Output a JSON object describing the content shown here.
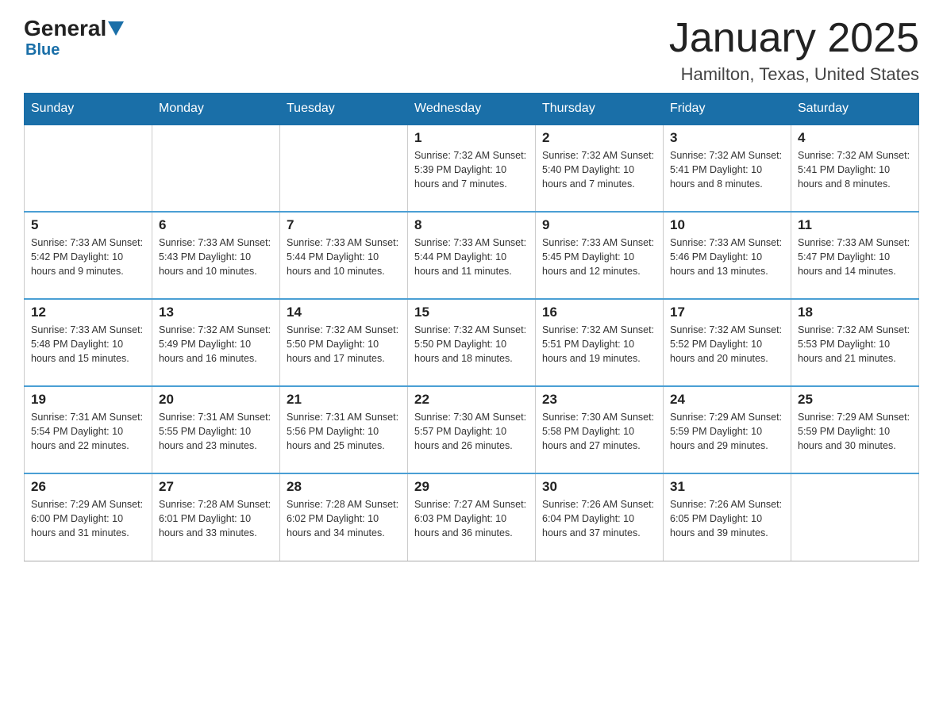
{
  "header": {
    "logo_general": "General",
    "logo_blue": "Blue",
    "title": "January 2025",
    "subtitle": "Hamilton, Texas, United States"
  },
  "days_of_week": [
    "Sunday",
    "Monday",
    "Tuesday",
    "Wednesday",
    "Thursday",
    "Friday",
    "Saturday"
  ],
  "weeks": [
    [
      {
        "day": "",
        "info": ""
      },
      {
        "day": "",
        "info": ""
      },
      {
        "day": "",
        "info": ""
      },
      {
        "day": "1",
        "info": "Sunrise: 7:32 AM\nSunset: 5:39 PM\nDaylight: 10 hours and 7 minutes."
      },
      {
        "day": "2",
        "info": "Sunrise: 7:32 AM\nSunset: 5:40 PM\nDaylight: 10 hours and 7 minutes."
      },
      {
        "day": "3",
        "info": "Sunrise: 7:32 AM\nSunset: 5:41 PM\nDaylight: 10 hours and 8 minutes."
      },
      {
        "day": "4",
        "info": "Sunrise: 7:32 AM\nSunset: 5:41 PM\nDaylight: 10 hours and 8 minutes."
      }
    ],
    [
      {
        "day": "5",
        "info": "Sunrise: 7:33 AM\nSunset: 5:42 PM\nDaylight: 10 hours and 9 minutes."
      },
      {
        "day": "6",
        "info": "Sunrise: 7:33 AM\nSunset: 5:43 PM\nDaylight: 10 hours and 10 minutes."
      },
      {
        "day": "7",
        "info": "Sunrise: 7:33 AM\nSunset: 5:44 PM\nDaylight: 10 hours and 10 minutes."
      },
      {
        "day": "8",
        "info": "Sunrise: 7:33 AM\nSunset: 5:44 PM\nDaylight: 10 hours and 11 minutes."
      },
      {
        "day": "9",
        "info": "Sunrise: 7:33 AM\nSunset: 5:45 PM\nDaylight: 10 hours and 12 minutes."
      },
      {
        "day": "10",
        "info": "Sunrise: 7:33 AM\nSunset: 5:46 PM\nDaylight: 10 hours and 13 minutes."
      },
      {
        "day": "11",
        "info": "Sunrise: 7:33 AM\nSunset: 5:47 PM\nDaylight: 10 hours and 14 minutes."
      }
    ],
    [
      {
        "day": "12",
        "info": "Sunrise: 7:33 AM\nSunset: 5:48 PM\nDaylight: 10 hours and 15 minutes."
      },
      {
        "day": "13",
        "info": "Sunrise: 7:32 AM\nSunset: 5:49 PM\nDaylight: 10 hours and 16 minutes."
      },
      {
        "day": "14",
        "info": "Sunrise: 7:32 AM\nSunset: 5:50 PM\nDaylight: 10 hours and 17 minutes."
      },
      {
        "day": "15",
        "info": "Sunrise: 7:32 AM\nSunset: 5:50 PM\nDaylight: 10 hours and 18 minutes."
      },
      {
        "day": "16",
        "info": "Sunrise: 7:32 AM\nSunset: 5:51 PM\nDaylight: 10 hours and 19 minutes."
      },
      {
        "day": "17",
        "info": "Sunrise: 7:32 AM\nSunset: 5:52 PM\nDaylight: 10 hours and 20 minutes."
      },
      {
        "day": "18",
        "info": "Sunrise: 7:32 AM\nSunset: 5:53 PM\nDaylight: 10 hours and 21 minutes."
      }
    ],
    [
      {
        "day": "19",
        "info": "Sunrise: 7:31 AM\nSunset: 5:54 PM\nDaylight: 10 hours and 22 minutes."
      },
      {
        "day": "20",
        "info": "Sunrise: 7:31 AM\nSunset: 5:55 PM\nDaylight: 10 hours and 23 minutes."
      },
      {
        "day": "21",
        "info": "Sunrise: 7:31 AM\nSunset: 5:56 PM\nDaylight: 10 hours and 25 minutes."
      },
      {
        "day": "22",
        "info": "Sunrise: 7:30 AM\nSunset: 5:57 PM\nDaylight: 10 hours and 26 minutes."
      },
      {
        "day": "23",
        "info": "Sunrise: 7:30 AM\nSunset: 5:58 PM\nDaylight: 10 hours and 27 minutes."
      },
      {
        "day": "24",
        "info": "Sunrise: 7:29 AM\nSunset: 5:59 PM\nDaylight: 10 hours and 29 minutes."
      },
      {
        "day": "25",
        "info": "Sunrise: 7:29 AM\nSunset: 5:59 PM\nDaylight: 10 hours and 30 minutes."
      }
    ],
    [
      {
        "day": "26",
        "info": "Sunrise: 7:29 AM\nSunset: 6:00 PM\nDaylight: 10 hours and 31 minutes."
      },
      {
        "day": "27",
        "info": "Sunrise: 7:28 AM\nSunset: 6:01 PM\nDaylight: 10 hours and 33 minutes."
      },
      {
        "day": "28",
        "info": "Sunrise: 7:28 AM\nSunset: 6:02 PM\nDaylight: 10 hours and 34 minutes."
      },
      {
        "day": "29",
        "info": "Sunrise: 7:27 AM\nSunset: 6:03 PM\nDaylight: 10 hours and 36 minutes."
      },
      {
        "day": "30",
        "info": "Sunrise: 7:26 AM\nSunset: 6:04 PM\nDaylight: 10 hours and 37 minutes."
      },
      {
        "day": "31",
        "info": "Sunrise: 7:26 AM\nSunset: 6:05 PM\nDaylight: 10 hours and 39 minutes."
      },
      {
        "day": "",
        "info": ""
      }
    ]
  ]
}
